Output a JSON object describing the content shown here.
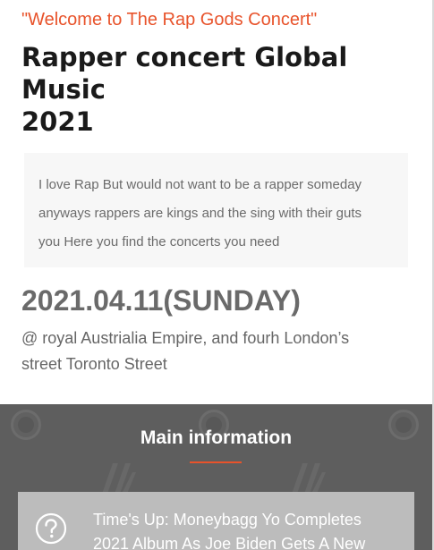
{
  "header": {
    "tagline": "\"Welcome to The Rap Gods Concert\"",
    "title_lines": [
      "Rapper concert Global",
      "Music",
      "2021"
    ]
  },
  "intro": {
    "lines": [
      "I love Rap But would not want to be a rapper someday",
      "anyways rappers are kings and the sing with their guts",
      "you Here you find the concerts you need"
    ]
  },
  "event": {
    "date": "2021.04.11(SUNDAY)",
    "venue_lines": [
      "@ royal Austrialia Empire, and fourh London’s",
      "street Toronto Street"
    ]
  },
  "main_info": {
    "heading": "Main information",
    "card": {
      "icon": "location-question-icon",
      "lines": [
        "Time's Up: Moneybagg Yo Completes",
        "2021 Album As Joe Biden Gets A New"
      ]
    }
  },
  "colors": {
    "accent": "#e8532b",
    "section_bg": "#5e5e5e",
    "card_bg": "#bcbcbc"
  }
}
